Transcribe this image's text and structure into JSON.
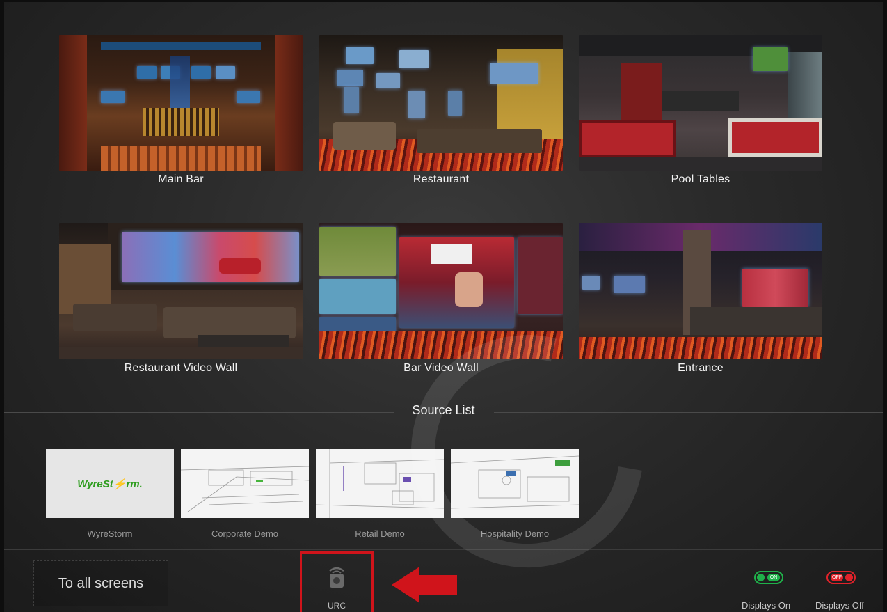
{
  "zones": [
    {
      "name": "Main Bar"
    },
    {
      "name": "Restaurant"
    },
    {
      "name": "Pool Tables"
    },
    {
      "name": "Restaurant Video Wall"
    },
    {
      "name": "Bar Video Wall"
    },
    {
      "name": "Entrance"
    }
  ],
  "source_list": {
    "title": "Source List",
    "items": [
      {
        "label": "WyreStorm",
        "logo_text": "WyreSt⚡rm."
      },
      {
        "label": "Corporate Demo"
      },
      {
        "label": "Retail Demo"
      },
      {
        "label": "Hospitality Demo"
      }
    ]
  },
  "bottom_bar": {
    "all_screens_label": "To all screens",
    "urc_label": "URC",
    "displays_on": {
      "label": "Displays On",
      "toggle_text": "ON",
      "color": "#1fb14a"
    },
    "displays_off": {
      "label": "Displays Off",
      "toggle_text": "OFF",
      "color": "#e0222a"
    }
  },
  "colors": {
    "highlight": "#d0141b",
    "brand_green": "#2e9d1f"
  }
}
